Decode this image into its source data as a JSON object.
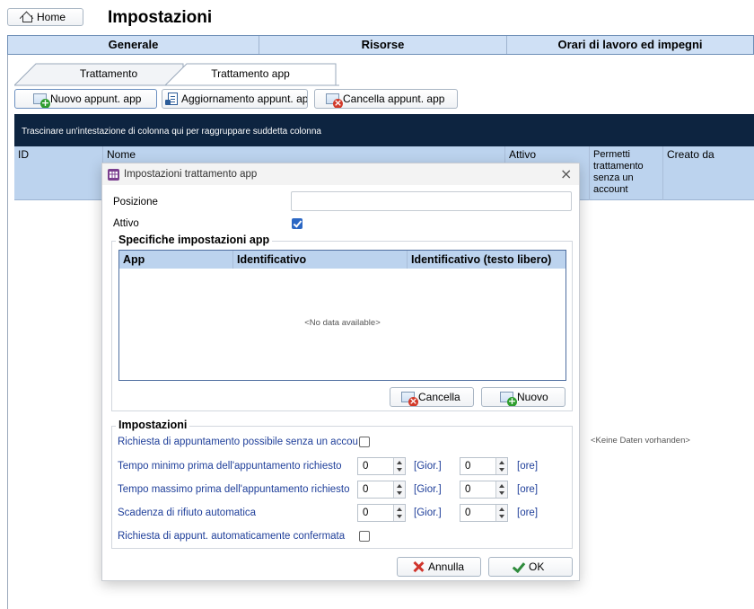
{
  "home_label": "Home",
  "page_title": "Impostazioni",
  "main_tabs": [
    "Generale",
    "Risorse",
    "Orari di lavoro ed impegni"
  ],
  "sub_tabs": [
    "Trattamento",
    "Trattamento app"
  ],
  "toolbar": {
    "new_label": "Nuovo appunt. app",
    "update_label": "Aggiornamento appunt. ap",
    "delete_label": "Cancella appunt. app"
  },
  "group_hint": "Trascinare un'intestazione di colonna qui per raggruppare suddetta colonna",
  "grid_columns": [
    "ID",
    "Nome",
    "Attivo",
    "Permetti trattamento senza un account",
    "Creato da"
  ],
  "grid_empty": "<Keine Daten vorhanden>",
  "dialog": {
    "title": "Impostazioni trattamento app",
    "posizione_label": "Posizione",
    "posizione_value": "",
    "attivo_label": "Attivo",
    "attivo_checked": true,
    "app_settings_legend": "Specifiche impostazioni app",
    "app_table_columns": [
      "App",
      "Identificativo",
      "Identificativo (testo libero)"
    ],
    "app_table_empty": "<No data available>",
    "cancella_label": "Cancella",
    "nuovo_label": "Nuovo",
    "settings_legend": "Impostazioni",
    "rows": [
      {
        "label": "Richiesta di appuntamento possibile senza un accou",
        "type": "checkbox",
        "checked": false
      },
      {
        "label": "Tempo minimo prima dell'appuntamento richiesto",
        "days": "0",
        "days_unit": "[Gior.]",
        "hours": "0",
        "hours_unit": "[ore]"
      },
      {
        "label": "Tempo massimo prima dell'appuntamento richiesto",
        "days": "0",
        "days_unit": "[Gior.]",
        "hours": "0",
        "hours_unit": "[ore]"
      },
      {
        "label": "Scadenza di rifiuto automatica",
        "days": "0",
        "days_unit": "[Gior.]",
        "hours": "0",
        "hours_unit": "[ore]"
      },
      {
        "label": "Richiesta di appunt. automaticamente confermata",
        "type": "checkbox",
        "checked": false
      }
    ],
    "annulla_label": "Annulla",
    "ok_label": "OK"
  }
}
